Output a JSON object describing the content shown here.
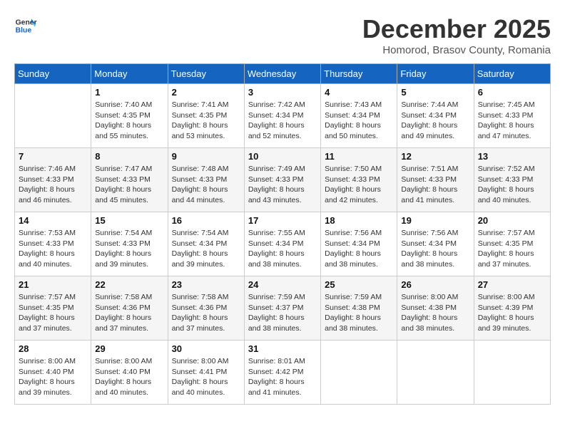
{
  "header": {
    "logo_line1": "General",
    "logo_line2": "Blue",
    "month": "December 2025",
    "location": "Homorod, Brasov County, Romania"
  },
  "days_of_week": [
    "Sunday",
    "Monday",
    "Tuesday",
    "Wednesday",
    "Thursday",
    "Friday",
    "Saturday"
  ],
  "weeks": [
    [
      {
        "day": "",
        "info": ""
      },
      {
        "day": "1",
        "info": "Sunrise: 7:40 AM\nSunset: 4:35 PM\nDaylight: 8 hours\nand 55 minutes."
      },
      {
        "day": "2",
        "info": "Sunrise: 7:41 AM\nSunset: 4:35 PM\nDaylight: 8 hours\nand 53 minutes."
      },
      {
        "day": "3",
        "info": "Sunrise: 7:42 AM\nSunset: 4:34 PM\nDaylight: 8 hours\nand 52 minutes."
      },
      {
        "day": "4",
        "info": "Sunrise: 7:43 AM\nSunset: 4:34 PM\nDaylight: 8 hours\nand 50 minutes."
      },
      {
        "day": "5",
        "info": "Sunrise: 7:44 AM\nSunset: 4:34 PM\nDaylight: 8 hours\nand 49 minutes."
      },
      {
        "day": "6",
        "info": "Sunrise: 7:45 AM\nSunset: 4:33 PM\nDaylight: 8 hours\nand 47 minutes."
      }
    ],
    [
      {
        "day": "7",
        "info": "Sunrise: 7:46 AM\nSunset: 4:33 PM\nDaylight: 8 hours\nand 46 minutes."
      },
      {
        "day": "8",
        "info": "Sunrise: 7:47 AM\nSunset: 4:33 PM\nDaylight: 8 hours\nand 45 minutes."
      },
      {
        "day": "9",
        "info": "Sunrise: 7:48 AM\nSunset: 4:33 PM\nDaylight: 8 hours\nand 44 minutes."
      },
      {
        "day": "10",
        "info": "Sunrise: 7:49 AM\nSunset: 4:33 PM\nDaylight: 8 hours\nand 43 minutes."
      },
      {
        "day": "11",
        "info": "Sunrise: 7:50 AM\nSunset: 4:33 PM\nDaylight: 8 hours\nand 42 minutes."
      },
      {
        "day": "12",
        "info": "Sunrise: 7:51 AM\nSunset: 4:33 PM\nDaylight: 8 hours\nand 41 minutes."
      },
      {
        "day": "13",
        "info": "Sunrise: 7:52 AM\nSunset: 4:33 PM\nDaylight: 8 hours\nand 40 minutes."
      }
    ],
    [
      {
        "day": "14",
        "info": "Sunrise: 7:53 AM\nSunset: 4:33 PM\nDaylight: 8 hours\nand 40 minutes."
      },
      {
        "day": "15",
        "info": "Sunrise: 7:54 AM\nSunset: 4:33 PM\nDaylight: 8 hours\nand 39 minutes."
      },
      {
        "day": "16",
        "info": "Sunrise: 7:54 AM\nSunset: 4:34 PM\nDaylight: 8 hours\nand 39 minutes."
      },
      {
        "day": "17",
        "info": "Sunrise: 7:55 AM\nSunset: 4:34 PM\nDaylight: 8 hours\nand 38 minutes."
      },
      {
        "day": "18",
        "info": "Sunrise: 7:56 AM\nSunset: 4:34 PM\nDaylight: 8 hours\nand 38 minutes."
      },
      {
        "day": "19",
        "info": "Sunrise: 7:56 AM\nSunset: 4:34 PM\nDaylight: 8 hours\nand 38 minutes."
      },
      {
        "day": "20",
        "info": "Sunrise: 7:57 AM\nSunset: 4:35 PM\nDaylight: 8 hours\nand 37 minutes."
      }
    ],
    [
      {
        "day": "21",
        "info": "Sunrise: 7:57 AM\nSunset: 4:35 PM\nDaylight: 8 hours\nand 37 minutes."
      },
      {
        "day": "22",
        "info": "Sunrise: 7:58 AM\nSunset: 4:36 PM\nDaylight: 8 hours\nand 37 minutes."
      },
      {
        "day": "23",
        "info": "Sunrise: 7:58 AM\nSunset: 4:36 PM\nDaylight: 8 hours\nand 37 minutes."
      },
      {
        "day": "24",
        "info": "Sunrise: 7:59 AM\nSunset: 4:37 PM\nDaylight: 8 hours\nand 38 minutes."
      },
      {
        "day": "25",
        "info": "Sunrise: 7:59 AM\nSunset: 4:38 PM\nDaylight: 8 hours\nand 38 minutes."
      },
      {
        "day": "26",
        "info": "Sunrise: 8:00 AM\nSunset: 4:38 PM\nDaylight: 8 hours\nand 38 minutes."
      },
      {
        "day": "27",
        "info": "Sunrise: 8:00 AM\nSunset: 4:39 PM\nDaylight: 8 hours\nand 39 minutes."
      }
    ],
    [
      {
        "day": "28",
        "info": "Sunrise: 8:00 AM\nSunset: 4:40 PM\nDaylight: 8 hours\nand 39 minutes."
      },
      {
        "day": "29",
        "info": "Sunrise: 8:00 AM\nSunset: 4:40 PM\nDaylight: 8 hours\nand 40 minutes."
      },
      {
        "day": "30",
        "info": "Sunrise: 8:00 AM\nSunset: 4:41 PM\nDaylight: 8 hours\nand 40 minutes."
      },
      {
        "day": "31",
        "info": "Sunrise: 8:01 AM\nSunset: 4:42 PM\nDaylight: 8 hours\nand 41 minutes."
      },
      {
        "day": "",
        "info": ""
      },
      {
        "day": "",
        "info": ""
      },
      {
        "day": "",
        "info": ""
      }
    ]
  ]
}
